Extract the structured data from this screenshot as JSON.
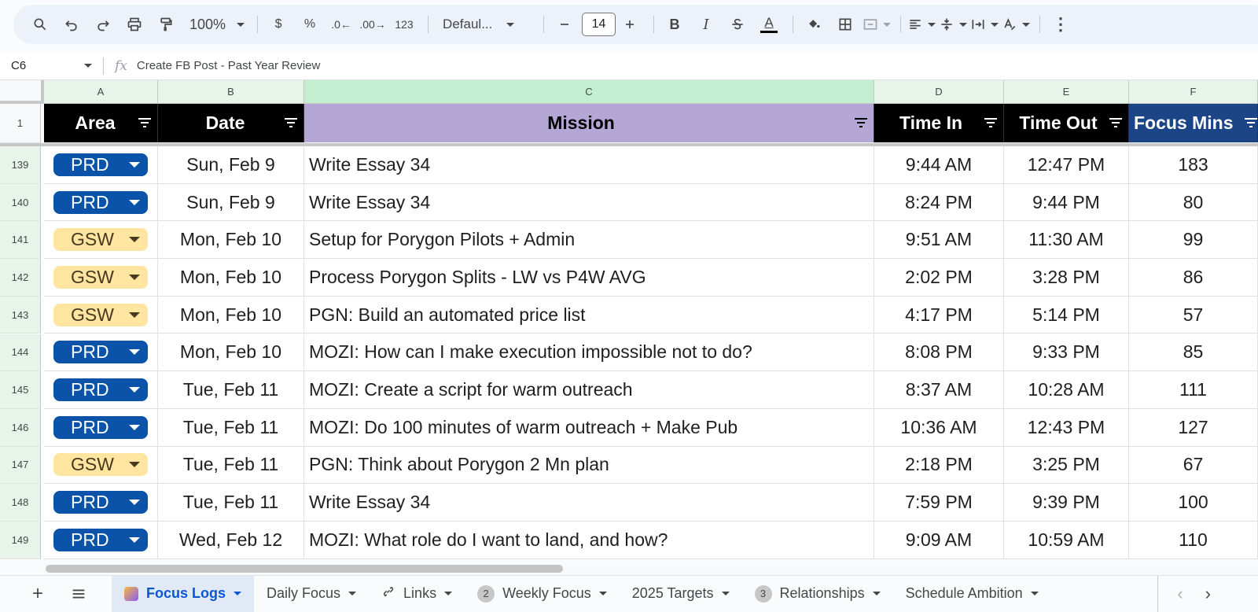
{
  "toolbar": {
    "zoom": "100%",
    "currency": "$",
    "percent": "%",
    "dec_decrease": ".0",
    "dec_increase": ".00",
    "number_format": "123",
    "font": "Defaul...",
    "font_size": "14",
    "bold": "B",
    "italic": "I",
    "text_color_letter": "A",
    "more": "⋮"
  },
  "formula_bar": {
    "cell_ref": "C6",
    "fx": "fx",
    "value": "Create FB Post - Past Year Review"
  },
  "columns": [
    {
      "letter": "A",
      "header": "Area"
    },
    {
      "letter": "B",
      "header": "Date"
    },
    {
      "letter": "C",
      "header": "Mission"
    },
    {
      "letter": "D",
      "header": "Time In"
    },
    {
      "letter": "E",
      "header": "Time Out"
    },
    {
      "letter": "F",
      "header": "Focus Mins"
    }
  ],
  "header_row_number": "1",
  "rows": [
    {
      "num": "139",
      "area": "PRD",
      "date": "Sun, Feb 9",
      "mission": "Write Essay 34",
      "time_in": "9:44 AM",
      "time_out": "12:47 PM",
      "mins": "183"
    },
    {
      "num": "140",
      "area": "PRD",
      "date": "Sun, Feb 9",
      "mission": "Write Essay 34",
      "time_in": "8:24 PM",
      "time_out": "9:44 PM",
      "mins": "80"
    },
    {
      "num": "141",
      "area": "GSW",
      "date": "Mon, Feb 10",
      "mission": "Setup for Porygon Pilots + Admin",
      "time_in": "9:51 AM",
      "time_out": "11:30 AM",
      "mins": "99"
    },
    {
      "num": "142",
      "area": "GSW",
      "date": "Mon, Feb 10",
      "mission": "Process Porygon Splits - LW vs P4W AVG",
      "time_in": "2:02 PM",
      "time_out": "3:28 PM",
      "mins": "86"
    },
    {
      "num": "143",
      "area": "GSW",
      "date": "Mon, Feb 10",
      "mission": "PGN: Build an automated price list",
      "time_in": "4:17 PM",
      "time_out": "5:14 PM",
      "mins": "57"
    },
    {
      "num": "144",
      "area": "PRD",
      "date": "Mon, Feb 10",
      "mission": "MOZI: How can I make execution impossible not to do?",
      "time_in": "8:08 PM",
      "time_out": "9:33 PM",
      "mins": "85"
    },
    {
      "num": "145",
      "area": "PRD",
      "date": "Tue, Feb 11",
      "mission": "MOZI: Create a script for warm outreach",
      "time_in": "8:37 AM",
      "time_out": "10:28 AM",
      "mins": "111"
    },
    {
      "num": "146",
      "area": "PRD",
      "date": "Tue, Feb 11",
      "mission": "MOZI: Do 100 minutes of warm outreach + Make Pub",
      "time_in": "10:36 AM",
      "time_out": "12:43 PM",
      "mins": "127"
    },
    {
      "num": "147",
      "area": "GSW",
      "date": "Tue, Feb 11",
      "mission": "PGN: Think about Porygon 2 Mn plan",
      "time_in": "2:18 PM",
      "time_out": "3:25 PM",
      "mins": "67"
    },
    {
      "num": "148",
      "area": "PRD",
      "date": "Tue, Feb 11",
      "mission": "Write Essay 34",
      "time_in": "7:59 PM",
      "time_out": "9:39 PM",
      "mins": "100"
    },
    {
      "num": "149",
      "area": "PRD",
      "date": "Wed, Feb 12",
      "mission": "MOZI: What role do I want to land, and how?",
      "time_in": "9:09 AM",
      "time_out": "10:59 AM",
      "mins": "110"
    }
  ],
  "tabs": [
    {
      "label": "Focus Logs",
      "active": true
    },
    {
      "label": "Daily Focus"
    },
    {
      "label": "Links"
    },
    {
      "label": "Weekly Focus",
      "badge": "2"
    },
    {
      "label": "2025 Targets"
    },
    {
      "label": "Relationships",
      "badge": "3"
    },
    {
      "label": "Schedule Ambition"
    }
  ],
  "colors": {
    "prd_chip": "#0a53a8",
    "gsw_chip": "#ffe5a0",
    "mission_header": "#b4a7d6",
    "focus_header": "#1c4587"
  }
}
